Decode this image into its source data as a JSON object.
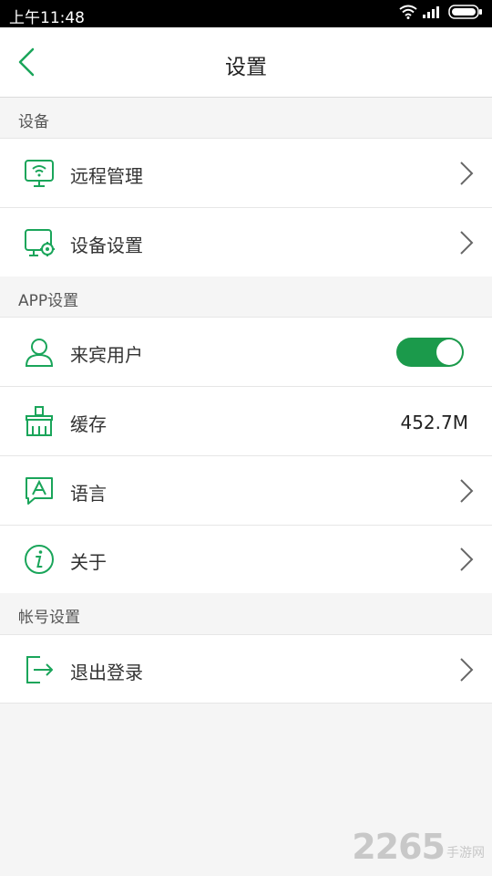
{
  "status_bar": {
    "time": "上午11:48",
    "icons": [
      "wifi-icon",
      "signal-icon",
      "battery-icon"
    ]
  },
  "header": {
    "title": "设置",
    "back_icon": "chevron-left-icon"
  },
  "sections": [
    {
      "label": "设备",
      "items": [
        {
          "label": "远程管理",
          "icon": "monitor-wifi-icon",
          "control": "chevron"
        },
        {
          "label": "设备设置",
          "icon": "monitor-gear-icon",
          "control": "chevron"
        }
      ]
    },
    {
      "label": "APP设置",
      "items": [
        {
          "label": "来宾用户",
          "icon": "user-icon",
          "control": "toggle",
          "toggle_on": true
        },
        {
          "label": "缓存",
          "icon": "broom-icon",
          "control": "value",
          "value": "452.7M"
        },
        {
          "label": "语言",
          "icon": "language-icon",
          "control": "chevron"
        },
        {
          "label": "关于",
          "icon": "info-icon",
          "control": "chevron"
        }
      ]
    },
    {
      "label": "帐号设置",
      "items": [
        {
          "label": "退出登录",
          "icon": "logout-icon",
          "control": "chevron"
        }
      ]
    }
  ],
  "watermark": {
    "number": "2265",
    "text": "手游网"
  },
  "colors": {
    "accent": "#1aa55a",
    "toggle_on": "#1b9a4b",
    "background": "#f5f5f5"
  }
}
